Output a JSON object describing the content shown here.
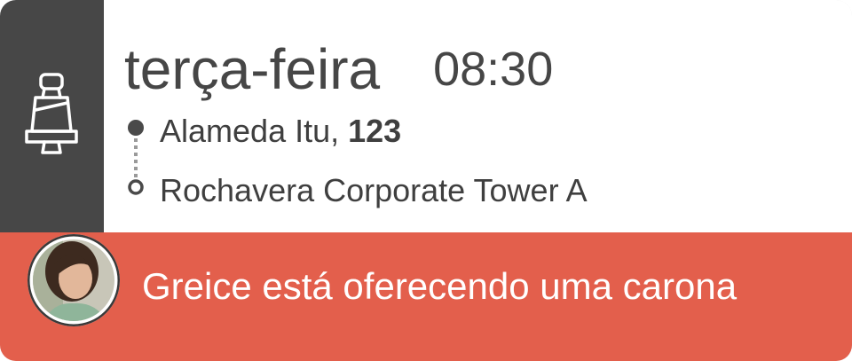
{
  "trip": {
    "day": "terça-feira",
    "time": "08:30"
  },
  "route": {
    "origin_street": "Alameda Itu,",
    "origin_number": "123",
    "destination": "Rochavera Corporate Tower A"
  },
  "offer": {
    "text": "Greice está oferecendo uma carona"
  },
  "icons": {
    "side": "car-seat-icon",
    "origin": "filled-dot-icon",
    "destination": "hollow-dot-icon"
  },
  "colors": {
    "sidebar": "#474747",
    "banner": "#e35f4c",
    "text": "#464646"
  }
}
